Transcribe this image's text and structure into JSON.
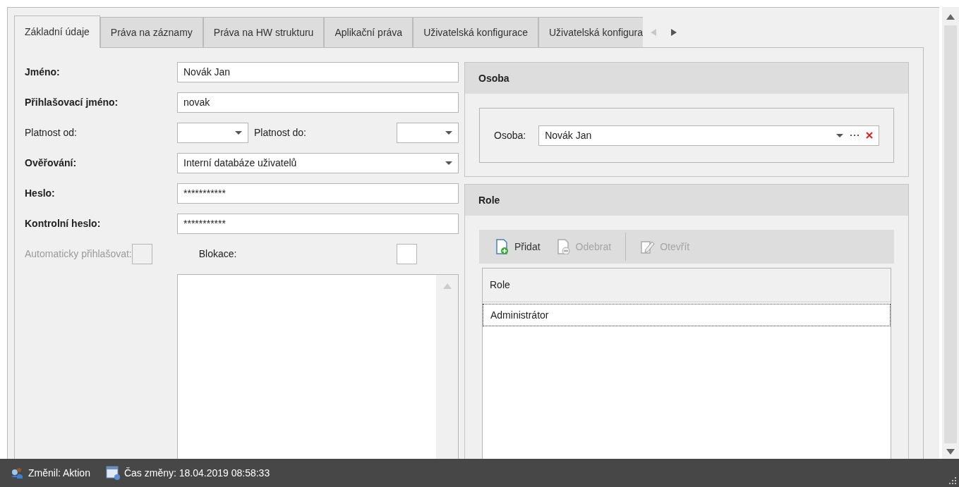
{
  "tabs": [
    {
      "label": "Základní údaje",
      "selected": true
    },
    {
      "label": "Práva na záznamy",
      "selected": false
    },
    {
      "label": "Práva na HW strukturu",
      "selected": false
    },
    {
      "label": "Aplikační práva",
      "selected": false
    },
    {
      "label": "Uživatelská konfigurace",
      "selected": false
    },
    {
      "label": "Uživatelská konfigura",
      "selected": false
    }
  ],
  "tab_arrows": [
    {
      "kind": "left",
      "disabled": true
    },
    {
      "kind": "right",
      "disabled": false
    }
  ],
  "form": [
    {
      "kind": "text",
      "label": "Jméno:",
      "required": true,
      "value": "Novák Jan"
    },
    {
      "kind": "text",
      "label": "Přihlašovací jméno:",
      "required": true,
      "value": "novak"
    },
    {
      "kind": "date_pair",
      "label": "Platnost od:",
      "required": false,
      "second_label": "Platnost do:"
    },
    {
      "kind": "select",
      "label": "Ověřování:",
      "required": true,
      "value": "Interní databáze uživatelů"
    },
    {
      "kind": "password",
      "label": "Heslo:",
      "required": true,
      "value": "***********"
    },
    {
      "kind": "password",
      "label": "Kontrolní heslo:",
      "required": true,
      "value": "***********"
    },
    {
      "kind": "checkbox_pair",
      "label": "Automaticky přihlašovat:",
      "required": false,
      "disabled": true,
      "checked": false,
      "second_label": "Blokace:",
      "second_checked": false
    },
    {
      "kind": "memo"
    }
  ],
  "osoba_panel": {
    "title": "Osoba",
    "field_label": "Osoba:",
    "value": "Novák Jan"
  },
  "role_panel": {
    "title": "Role",
    "toolbar": [
      {
        "kind": "add",
        "label": "Přidat",
        "disabled": false
      },
      {
        "kind": "remove",
        "label": "Odebrat",
        "disabled": true
      },
      {
        "kind": "edit",
        "label": "Otevřít",
        "disabled": true
      }
    ],
    "grid": {
      "columns": [
        "Role"
      ],
      "rows": [
        {
          "role": "Administrátor",
          "selected": true
        }
      ]
    }
  },
  "status_bar": [
    {
      "kind": "user",
      "text": "Změnil: Aktion"
    },
    {
      "kind": "calendar",
      "text": "Čas změny: 18.04.2019 08:58:33"
    }
  ]
}
